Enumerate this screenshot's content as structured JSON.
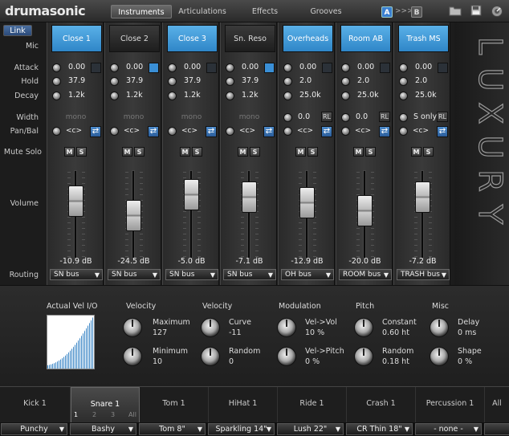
{
  "app": {
    "logo": "drumasonic"
  },
  "top_tabs": [
    "Instruments",
    "Articulations",
    "Effects",
    "Grooves"
  ],
  "ab": {
    "a": "A",
    "arrows": ">>>",
    "b": "B"
  },
  "left_labels": {
    "link": "Link",
    "mic": "Mic",
    "attack": "Attack",
    "hold": "Hold",
    "decay": "Decay",
    "width": "Width",
    "panbal": "Pan/Bal",
    "mutesolo": "Mute Solo",
    "volume": "Volume",
    "routing": "Routing"
  },
  "channels": [
    {
      "name": "Close 1",
      "active": true,
      "attack": "0.00",
      "hold": "37.9",
      "decay": "1.2k",
      "width": "mono",
      "pan": "<c>",
      "db": "-10.9 dB",
      "route": "SN bus",
      "level": 0.78
    },
    {
      "name": "Close 2",
      "active": false,
      "attack": "0.00",
      "hold": "37.9",
      "decay": "1.2k",
      "width": "mono",
      "pan": "<c>",
      "db": "-24.5 dB",
      "route": "SN bus",
      "level": 0.47
    },
    {
      "name": "Close 3",
      "active": true,
      "attack": "0.00",
      "hold": "37.9",
      "decay": "1.2k",
      "width": "mono",
      "pan": "<c>",
      "db": "-5.0 dB",
      "route": "SN bus",
      "level": 0.92
    },
    {
      "name": "Sn. Reso",
      "active": false,
      "attack": "0.00",
      "hold": "37.9",
      "decay": "1.2k",
      "width": "mono",
      "pan": "<c>",
      "db": "-7.1 dB",
      "route": "SN bus",
      "level": 0.86
    },
    {
      "name": "Overheads",
      "active": true,
      "attack": "0.00",
      "hold": "2.0",
      "decay": "25.0k",
      "width": "0.0",
      "pan": "<c>",
      "db": "-12.9 dB",
      "route": "OH bus",
      "level": 0.74
    },
    {
      "name": "Room AB",
      "active": true,
      "attack": "0.00",
      "hold": "2.0",
      "decay": "25.0k",
      "width": "0.0",
      "pan": "<c>",
      "db": "-20.0 dB",
      "route": "ROOM bus",
      "level": 0.57
    },
    {
      "name": "Trash MS",
      "active": true,
      "attack": "0.00",
      "hold": "2.0",
      "decay": "25.0k",
      "width": "S only",
      "pan": "<c>",
      "db": "-7.2 dB",
      "route": "TRASH bus",
      "level": 0.86
    }
  ],
  "channel_labels": {
    "mute": "M",
    "solo": "S",
    "rl": "RL",
    "swap": "⇄"
  },
  "brand_vertical": [
    "L",
    "U",
    "X",
    "U",
    "R",
    "Y"
  ],
  "lower": {
    "vel_title": "Actual Vel I/O",
    "velocity1": {
      "title": "Velocity",
      "max_label": "Maximum",
      "max": "127",
      "min_label": "Minimum",
      "min": "10"
    },
    "velocity2": {
      "title": "Velocity",
      "curve_label": "Curve",
      "curve": "-11",
      "random_label": "Random",
      "random": "0"
    },
    "modulation": {
      "title": "Modulation",
      "vol_label": "Vel->Vol",
      "vol": "10 %",
      "pitch_label": "Vel->Pitch",
      "pitch": "0 %"
    },
    "pitch": {
      "title": "Pitch",
      "const_label": "Constant",
      "const": "0.60 ht",
      "rand_label": "Random",
      "rand": "0.18 ht"
    },
    "misc": {
      "title": "Misc",
      "delay_label": "Delay",
      "delay": "0 ms",
      "shape_label": "Shape",
      "shape": "0 %"
    }
  },
  "drum_tabs": [
    "Kick 1",
    "Snare 1",
    "Tom 1",
    "HiHat 1",
    "Ride 1",
    "Crash 1",
    "Percussion 1",
    "All"
  ],
  "snare_sub": [
    "1",
    "2",
    "3",
    "All"
  ],
  "kits": [
    "Punchy",
    "Bashy",
    "Tom 8\"",
    "Sparkling 14\"",
    "Lush 22\"",
    "CR Thin 18\"",
    "- none -",
    ""
  ]
}
